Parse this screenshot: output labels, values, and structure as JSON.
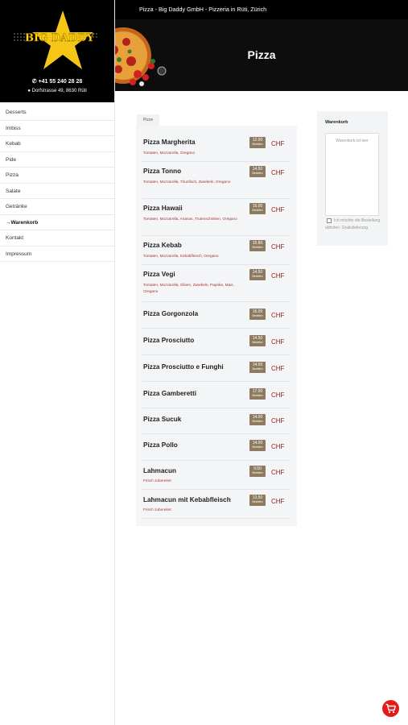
{
  "brand": {
    "logo_text": "BIG DADDY",
    "phone": "+41 55 240 28 28",
    "address": "Dorfstrasse 49, 8630 Rüti"
  },
  "top_bar": {
    "title": "Pizza - Big Daddy GmbH - Pizzeria in Rüti, Zürich"
  },
  "hero": {
    "title": "Pizza"
  },
  "nav": {
    "items": [
      {
        "label": "Desserts"
      },
      {
        "label": "Imbiss"
      },
      {
        "label": "Kebab"
      },
      {
        "label": "Pide"
      },
      {
        "label": "Pizza"
      },
      {
        "label": "Salate"
      },
      {
        "label": "Getränke"
      },
      {
        "label": "→Warenkorb"
      },
      {
        "label": "Kontakt"
      },
      {
        "label": "Impressum"
      }
    ]
  },
  "menu": {
    "tab_label": "Pizze",
    "currency": "CHF",
    "order_label": "Bestellen",
    "items": [
      {
        "name": "Pizza Margherita",
        "desc": "Tomaten, Mozzarella, Oregano",
        "price": "12.00"
      },
      {
        "name": "Pizza Tonno",
        "desc": "Tomaten, Mozzarella, Thunfisch, Zwiebeln, Oregano",
        "price": "14.50"
      },
      {
        "name": "Pizza Hawaii",
        "desc": "Tomaten, Mozzarella, Ananas, Trutenschinken, Oregano",
        "price": "16.00"
      },
      {
        "name": "Pizza Kebab",
        "desc": "Tomaten, Mozzarella, Kebabfleisch, Oregano",
        "price": "15.80"
      },
      {
        "name": "Pizza Vegi",
        "desc": "Tomaten, Mozzarella, Oliven, Zwiebeln, Paprika, Mais, Oregano",
        "price": "14.50"
      },
      {
        "name": "Pizza Gorgonzola",
        "desc": "",
        "price": "16.00"
      },
      {
        "name": "Pizza Prosciutto",
        "desc": "",
        "price": "14.50"
      },
      {
        "name": "Pizza Prosciutto e Funghi",
        "desc": "",
        "price": "14.50"
      },
      {
        "name": "Pizza Gamberetti",
        "desc": "",
        "price": "17.00"
      },
      {
        "name": "Pizza Sucuk",
        "desc": "",
        "price": "14.00"
      },
      {
        "name": "Pizza Pollo",
        "desc": "",
        "price": "14.00"
      },
      {
        "name": "Lahmacun",
        "desc": "Frisch zubereitet",
        "price": "9.50"
      },
      {
        "name": "Lahmacun mit Kebabfleisch",
        "desc": "Frisch zubereitet",
        "price": "13.50"
      }
    ]
  },
  "cart": {
    "title": "Warenkorb",
    "empty_text": "Warenkorb ist leer",
    "pickup_label": "Ich möchte die Bestellung abholen: Gratislieferung"
  },
  "fab": {
    "icon": "shopping-cart-icon"
  },
  "colors": {
    "accent": "#e41b1b",
    "price_badge": "#8c7b60",
    "chf": "#8a1f1f",
    "logo_gold": "#f5c518"
  }
}
